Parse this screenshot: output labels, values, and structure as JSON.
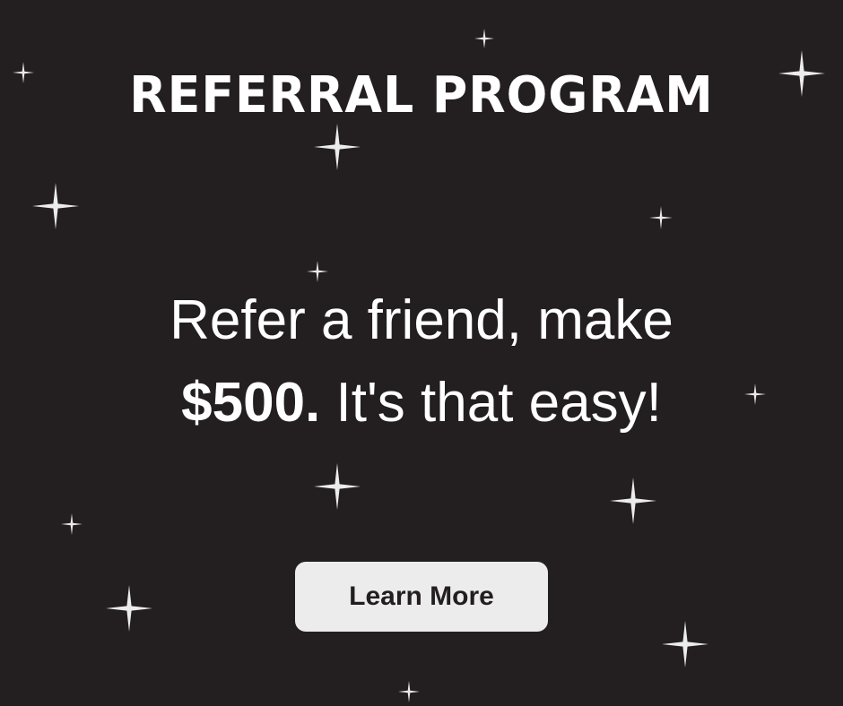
{
  "banner": {
    "title": "REFERRAL PROGRAM",
    "headline_part1": "Refer a friend, make",
    "headline_amount": "$500.",
    "headline_part2": " It's that easy!",
    "cta_label": "Learn More"
  },
  "colors": {
    "background": "#231f20",
    "text": "#ffffff",
    "button_background": "#ececec",
    "button_text": "#231f20"
  },
  "decorations": {
    "sparkle_icon": "four-point-star"
  }
}
